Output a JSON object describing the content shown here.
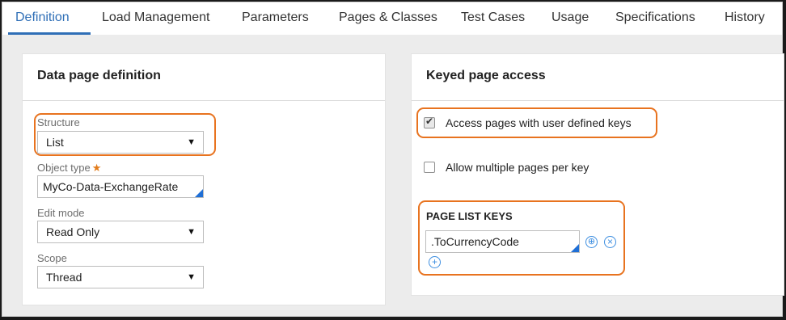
{
  "tabs": [
    {
      "label": "Definition"
    },
    {
      "label": "Load Management"
    },
    {
      "label": "Parameters"
    },
    {
      "label": "Pages & Classes"
    },
    {
      "label": "Test Cases"
    },
    {
      "label": "Usage"
    },
    {
      "label": "Specifications"
    },
    {
      "label": "History"
    }
  ],
  "active_tab": "Definition",
  "left_panel": {
    "title": "Data page definition",
    "structure": {
      "label": "Structure",
      "value": "List"
    },
    "object_type": {
      "label": "Object type",
      "required_mark": "★",
      "value": "MyCo-Data-ExchangeRate"
    },
    "edit_mode": {
      "label": "Edit mode",
      "value": "Read Only"
    },
    "scope": {
      "label": "Scope",
      "value": "Thread"
    }
  },
  "right_panel": {
    "title": "Keyed page access",
    "access_keys": {
      "label": "Access pages with user defined keys",
      "checked": true
    },
    "multiple_pages": {
      "label": "Allow multiple pages per key",
      "checked": false
    },
    "page_list_keys": {
      "title": "PAGE LIST KEYS",
      "key_value": ".ToCurrencyCode"
    }
  },
  "colors": {
    "accent": "#2f6fb7",
    "highlight": "#e8731f",
    "required": "#e27b1a"
  }
}
